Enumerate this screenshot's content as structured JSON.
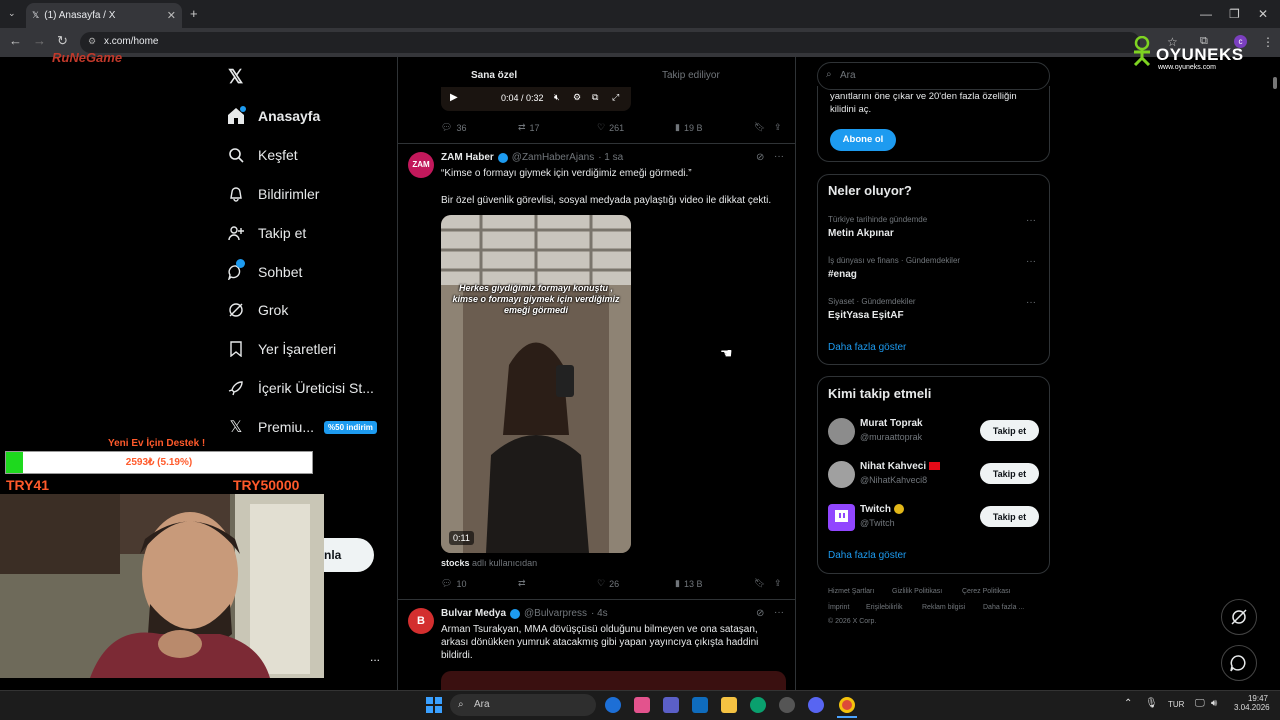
{
  "browser": {
    "tab_title": "(1) Anasayfa / X",
    "url": "x.com/home",
    "new_tab": "+",
    "back": "←",
    "forward": "→",
    "reload": "↻",
    "minimize": "—",
    "maximize": "❐",
    "close": "✕"
  },
  "watermarks": {
    "top_left": "RuNeGame",
    "oyuneks_brand": "OYUNEKS",
    "oyuneks_url": "www.oyuneks.com"
  },
  "nav": {
    "x_logo": "𝕏",
    "items": [
      {
        "label": "Anasayfa",
        "icon": "home-icon"
      },
      {
        "label": "Keşfet",
        "icon": "search-icon"
      },
      {
        "label": "Bildirimler",
        "icon": "bell-icon"
      },
      {
        "label": "Takip et",
        "icon": "person-add-icon"
      },
      {
        "label": "Sohbet",
        "icon": "chat-icon"
      },
      {
        "label": "Grok",
        "icon": "grok-icon"
      },
      {
        "label": "Yer İşaretleri",
        "icon": "bookmark-icon"
      },
      {
        "label": "İçerik Üreticisi St...",
        "icon": "rocket-icon"
      },
      {
        "label": "Premiu...",
        "icon": "x-icon"
      }
    ],
    "premium_badge": "%50 indirim",
    "post_button_partial": "nla",
    "more_dots": "..."
  },
  "donation": {
    "title": "Yeni Ev İçin Destek !",
    "progress_text": "2593₺ (5.19%)",
    "progress_fraction": 0.0519,
    "min_label": "TRY41",
    "max_label": "TRY50000"
  },
  "feed": {
    "tab_for_you": "Sana özel",
    "tab_following": "Takip ediliyor",
    "prev_video_time": "0:04 / 0:32",
    "prev_actions": {
      "replies": "36",
      "reposts": "17",
      "likes": "261",
      "views": "19 B"
    },
    "tweet1": {
      "avatar_text": "ZAM",
      "name": "ZAM Haber",
      "handle": "@ZamHaberAjans",
      "time": "· 1 sa",
      "text1": "“Kimse o formayı giymek için verdiğimiz emeği görmedi.”",
      "text2": "Bir özel güvenlik görevlisi, sosyal medyada paylaştığı video ile dikkat çekti.",
      "video_caption": "Herkes giydiğimiz formayı konuştu , kimse o formayı giymek için verdiğimiz emeği görmedi",
      "video_duration": "0:11",
      "source_user": "stocks",
      "source_suffix": "adlı kullanıcıdan",
      "actions": {
        "replies": "10",
        "likes": "26",
        "views": "13 B"
      }
    },
    "tweet2": {
      "avatar_text": "B",
      "name": "Bulvar Medya",
      "handle": "@Bulvarpress",
      "time": "· 4s",
      "text": "Arman Tsurakyan, MMA dövüşçüsü olduğunu bilmeyen ve ona sataşan, arkası dönükken yumruk atacakmış gibi yapan yayıncıya çıkışta haddini bildirdi."
    }
  },
  "right": {
    "search_placeholder": "Ara",
    "premium_text1": "yanıtlarını öne çıkar ve 20'den fazla özelliğin",
    "premium_text2": "kilidini aç.",
    "subscribe_button": "Abone ol",
    "trends_title": "Neler oluyor?",
    "trends": [
      {
        "category": "Türkiye tarihinde gündemde",
        "name": "Metin Akpınar"
      },
      {
        "category": "İş dünyası ve finans · Gündemdekiler",
        "name": "#enag"
      },
      {
        "category": "Siyaset · Gündemdekiler",
        "name": "EşitYasa EşitAF"
      }
    ],
    "show_more": "Daha fazla göster",
    "who_title": "Kimi takip etmeli",
    "who": [
      {
        "name": "Murat Toprak",
        "handle": "@muraattoprak"
      },
      {
        "name": "Nihat Kahveci",
        "handle": "@NihatKahveci8"
      },
      {
        "name": "Twitch",
        "handle": "@Twitch"
      }
    ],
    "follow_label": "Takip et",
    "footer": [
      "Hizmet Şartları",
      "Gizlilik Politikası",
      "Çerez Politikası",
      "İmprint",
      "Erişilebilirlik",
      "Reklam bilgisi",
      "Daha fazla ..."
    ],
    "copyright": "© 2026 X Corp."
  },
  "taskbar": {
    "search": "Ara",
    "lang": "TUR",
    "time": "19:47",
    "date": "3.04.2026"
  }
}
